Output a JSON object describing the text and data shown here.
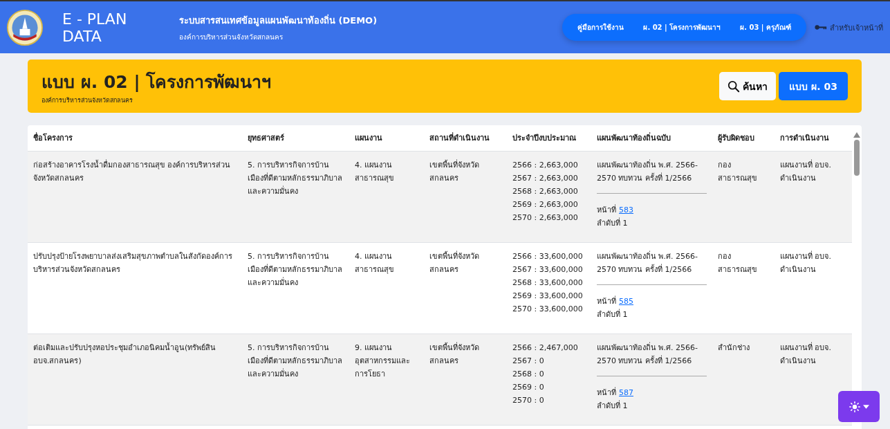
{
  "header": {
    "brand": "E - PLAN DATA",
    "system_title": "ระบบสารสนเทศข้อมูลแผนพัฒนาท้องถิ่น (DEMO)",
    "organization": "องค์การบริหารส่วนจังหวัดสกลนคร",
    "nav": [
      {
        "label": "คู่มือการใช้งาน"
      },
      {
        "label": "ผ. 02 | โครงการพัฒนาฯ"
      },
      {
        "label": "ผ. 03 | ครุภัณฑ์"
      }
    ],
    "staff_link": "สำหรับเจ้าหน้าที่"
  },
  "banner": {
    "title": "แบบ ผ. 02 | โครงการพัฒนาฯ",
    "subtitle": "องค์การบริหารส่วนจังหวัดสกลนคร",
    "search_button": "ค้นหา",
    "form_button": "แบบ ผ. 03"
  },
  "table": {
    "columns": [
      "ชื่อโครงการ",
      "ยุทธศาสตร์",
      "แผนงาน",
      "สถานที่ดำเนินงาน",
      "ประจำปีงบประมาณ",
      "แผนพัฒนาท้องถิ่นฉบับ",
      "ผู้รับผิดชอบ",
      "การดำเนินงาน"
    ],
    "rows": [
      {
        "name": "ก่อสร้างอาคารโรงน้ำดื่มกองสาธารณสุข องค์การบริหารส่วนจังหวัดสกลนคร",
        "strategy": "5. การบริหารกิจการบ้านเมืองที่ดีตามหลักธรรมาภิบาลและความมั่นคง",
        "plan": "4. แผนงานสาธารณสุข",
        "location": "เขตพื้นที่จังหวัดสกลนคร",
        "budget": [
          "2566 : 2,663,000",
          "2567 : 2,663,000",
          "2568 : 2,663,000",
          "2569 : 2,663,000",
          "2570 : 2,663,000"
        ],
        "local_plan": "แผนพัฒนาท้องถิ่น พ.ศ. 2566-2570 ทบทวน ครั้งที่ 1/2566",
        "page_label": "หน้าที่",
        "page_link": "583",
        "order": "ลำดับที่ 1",
        "responsible": "กองสาธารณสุข",
        "action": "แผนงานที่ อบจ. ดำเนินงาน"
      },
      {
        "name": "ปรับปรุงป้ายโรงพยาบาลส่งเสริมสุขภาพตำบลในสังกัดองค์การบริหารส่วนจังหวัดสกลนคร",
        "strategy": "5. การบริหารกิจการบ้านเมืองที่ดีตามหลักธรรมาภิบาลและความมั่นคง",
        "plan": "4. แผนงานสาธารณสุข",
        "location": "เขตพื้นที่จังหวัดสกลนคร",
        "budget": [
          "2566 : 33,600,000",
          "2567 : 33,600,000",
          "2568 : 33,600,000",
          "2569 : 33,600,000",
          "2570 : 33,600,000"
        ],
        "local_plan": "แผนพัฒนาท้องถิ่น พ.ศ. 2566-2570 ทบทวน ครั้งที่ 1/2566",
        "page_label": "หน้าที่",
        "page_link": "585",
        "order": "ลำดับที่ 1",
        "responsible": "กองสาธารณสุข",
        "action": "แผนงานที่ อบจ. ดำเนินงาน"
      },
      {
        "name": "ต่อเติมและปรับปรุงหอประชุมอำเภอนิคมน้ำอูน(ทรัพย์สิน อบจ.สกลนคร)",
        "strategy": "5. การบริหารกิจการบ้านเมืองที่ดีตามหลักธรรมาภิบาลและความมั่นคง",
        "plan": "9. แผนงานอุตสาหกรรมและการโยธา",
        "location": "เขตพื้นที่จังหวัดสกลนคร",
        "budget": [
          "2566 : 2,467,000",
          "2567 : 0",
          "2568 : 0",
          "2569 : 0",
          "2570 : 0"
        ],
        "local_plan": "แผนพัฒนาท้องถิ่น พ.ศ. 2566-2570 ทบทวน ครั้งที่ 1/2566",
        "page_label": "หน้าที่",
        "page_link": "587",
        "order": "ลำดับที่ 1",
        "responsible": "สำนักช่าง",
        "action": "แผนงานที่ อบจ. ดำเนินงาน"
      }
    ]
  }
}
